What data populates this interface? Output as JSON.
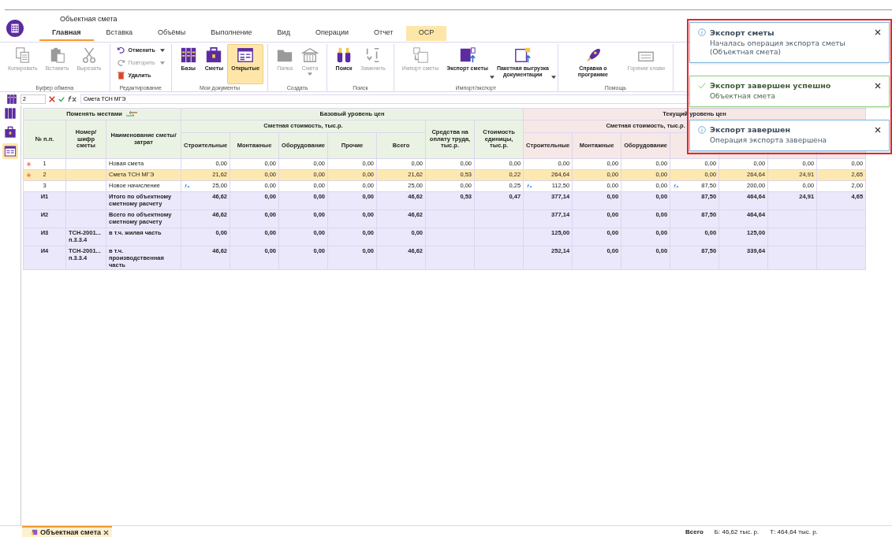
{
  "window": {
    "title": "Объектная смета"
  },
  "tabs": [
    {
      "label": "Главная",
      "selected": true,
      "highlighted": false
    },
    {
      "label": "Вставка",
      "selected": false,
      "highlighted": false
    },
    {
      "label": "Объёмы",
      "selected": false,
      "highlighted": false
    },
    {
      "label": "Выполнение",
      "selected": false,
      "highlighted": false
    },
    {
      "label": "Вид",
      "selected": false,
      "highlighted": false
    },
    {
      "label": "Операции",
      "selected": false,
      "highlighted": false
    },
    {
      "label": "Отчет",
      "selected": false,
      "highlighted": false
    },
    {
      "label": "ОСР",
      "selected": false,
      "highlighted": true
    }
  ],
  "ribbon": {
    "groups": [
      {
        "title": "Буфер обмена",
        "kind": "large",
        "items": [
          {
            "label": "Копировать",
            "disabled": true,
            "dropdown": false,
            "selected": false
          },
          {
            "label": "Вставить",
            "disabled": true,
            "dropdown": false,
            "selected": false
          },
          {
            "label": "Вырезать",
            "disabled": true,
            "dropdown": false,
            "selected": false
          }
        ]
      },
      {
        "title": "Редактирование",
        "kind": "small",
        "items": [
          {
            "label": "Отменить",
            "disabled": false,
            "dropdown": true,
            "selected": false
          },
          {
            "label": "Повторить",
            "disabled": true,
            "dropdown": true,
            "selected": false
          },
          {
            "label": "Удалить",
            "disabled": false,
            "dropdown": false,
            "selected": false
          }
        ]
      },
      {
        "title": "Мои документы",
        "kind": "large",
        "items": [
          {
            "label": "Базы",
            "disabled": false,
            "dropdown": false,
            "selected": false
          },
          {
            "label": "Сметы",
            "disabled": false,
            "dropdown": false,
            "selected": false
          },
          {
            "label": "Открытые",
            "disabled": false,
            "dropdown": false,
            "selected": true
          }
        ]
      },
      {
        "title": "Создать",
        "kind": "large",
        "items": [
          {
            "label": "Папка",
            "disabled": true,
            "dropdown": false,
            "selected": false
          },
          {
            "label": "Смета",
            "disabled": true,
            "dropdown": true,
            "selected": false
          }
        ]
      },
      {
        "title": "Поиск",
        "kind": "large",
        "items": [
          {
            "label": "Поиск",
            "disabled": false,
            "dropdown": false,
            "selected": false
          },
          {
            "label": "Заменить",
            "disabled": true,
            "dropdown": false,
            "selected": false
          }
        ]
      },
      {
        "title": "Импорт/экспорт",
        "kind": "large",
        "items": [
          {
            "label": "Импорт сметы",
            "disabled": true,
            "dropdown": false,
            "selected": false
          },
          {
            "label": "Экспорт сметы",
            "disabled": false,
            "dropdown": true,
            "selected": false
          },
          {
            "label": "Пакетная выгрузка документации",
            "disabled": false,
            "dropdown": true,
            "selected": false
          }
        ]
      },
      {
        "title": "Помощь",
        "kind": "large",
        "items": [
          {
            "label": "Справка о программе",
            "disabled": false,
            "dropdown": false,
            "selected": false
          },
          {
            "label": "Горячие клави",
            "disabled": true,
            "dropdown": false,
            "selected": false
          }
        ]
      }
    ]
  },
  "formula_bar": {
    "cell": "2",
    "value": "Смета ТСН МГЭ"
  },
  "side_tools": [
    {
      "selected": false
    },
    {
      "selected": false
    },
    {
      "selected": true
    }
  ],
  "table": {
    "swap_label": "Поменять местами",
    "fixed_columns": [
      "№ п.п.",
      "Номер/шифр сметы",
      "Наименование сметы/ затрат"
    ],
    "groups": [
      {
        "title": "Базовый уровень цен",
        "kind": "base",
        "cost_header": "Сметная стоимость, тыс.р.",
        "columns": [
          "Строительные",
          "Монтажные",
          "Оборудование",
          "Прочие",
          "Всего"
        ],
        "extra_columns": [
          "Средства на оплату труда, тыс.р.",
          "Стоимость единицы, тыс.р."
        ]
      },
      {
        "title": "Текущий уровень цен",
        "kind": "current",
        "cost_header": "Сметная стоимость, тыс.р.",
        "columns": [
          "Строительные",
          "Монтажные",
          "Оборудование"
        ]
      }
    ],
    "rows": [
      {
        "number": "1",
        "name": "Новая смета",
        "kind": "item",
        "selected": false,
        "marked": true,
        "cells": [
          "0,00",
          "0,00",
          "0,00",
          "0,00",
          "0,00",
          "0,00",
          "0,00",
          "0,00",
          "0,00",
          "0,00",
          "0,00",
          "0,00",
          "0,00",
          "0,00"
        ]
      },
      {
        "number": "2",
        "name": "Смета ТСН МГЭ",
        "kind": "item",
        "selected": true,
        "marked": true,
        "cells": [
          "21,62",
          "0,00",
          "0,00",
          "0,00",
          "21,62",
          "0,53",
          "0,22",
          "264,64",
          "0,00",
          "0,00",
          "0,00",
          "264,64",
          "24,91",
          "2,65"
        ]
      },
      {
        "number": "3",
        "name": "Новое начисление",
        "kind": "item",
        "selected": false,
        "marked": false,
        "cells": [
          {
            "text": "25,00",
            "formula": true
          },
          "0,00",
          "0,00",
          "0,00",
          "25,00",
          "0,00",
          "0,25",
          {
            "text": "112,50",
            "formula": true
          },
          "0,00",
          "0,00",
          {
            "text": "87,50",
            "formula": true
          },
          "200,00",
          "0,00",
          "2,00"
        ]
      },
      {
        "number": "И1",
        "name": "Итого по объектному сметному расчету",
        "kind": "total",
        "selected": false,
        "marked": false,
        "cells": [
          "46,62",
          "0,00",
          "0,00",
          "0,00",
          "46,62",
          "0,53",
          "0,47",
          "377,14",
          "0,00",
          "0,00",
          "87,50",
          "464,64",
          "24,91",
          "4,65"
        ]
      },
      {
        "number": "И2",
        "name": "Всего по объектному сметному расчету",
        "kind": "total",
        "selected": false,
        "marked": false,
        "cells": [
          "46,62",
          "0,00",
          "0,00",
          "0,00",
          "46,62",
          null,
          null,
          "377,14",
          "0,00",
          "0,00",
          "87,50",
          "464,64",
          null,
          null
        ]
      },
      {
        "number": "И3",
        "code": "ТСН-2001... п.3.3.4",
        "name": "в т.ч. жилая часть",
        "kind": "total",
        "selected": false,
        "marked": false,
        "cells": [
          "0,00",
          "0,00",
          "0,00",
          "0,00",
          "0,00",
          null,
          null,
          "125,00",
          "0,00",
          "0,00",
          "0,00",
          "125,00",
          null,
          null
        ]
      },
      {
        "number": "И4",
        "code": "ТСН-2001... п.3.3.4",
        "name": "в т.ч. производственная часть",
        "kind": "total",
        "selected": false,
        "marked": false,
        "cells": [
          "46,62",
          "0,00",
          "0,00",
          "0,00",
          "46,62",
          null,
          null,
          "252,14",
          "0,00",
          "0,00",
          "87,50",
          "339,64",
          null,
          null
        ]
      }
    ]
  },
  "document_tabs": [
    {
      "label": "Объектная смета",
      "selected": true
    }
  ],
  "status_bar": {
    "label": "Всего",
    "base": "Б: 46,62 тыс. р.",
    "current": "Т: 464,64 тыс. р."
  },
  "notifications": [
    {
      "kind": "info",
      "title": "Экспорт сметы",
      "message": "Началась операция экспорта сметы (Объектная смета)"
    },
    {
      "kind": "success",
      "title": "Экспорт завершен успешно",
      "message": "Объектная смета"
    },
    {
      "kind": "info",
      "title": "Экспорт завершен",
      "message": "Операция экспорта завершена"
    }
  ]
}
